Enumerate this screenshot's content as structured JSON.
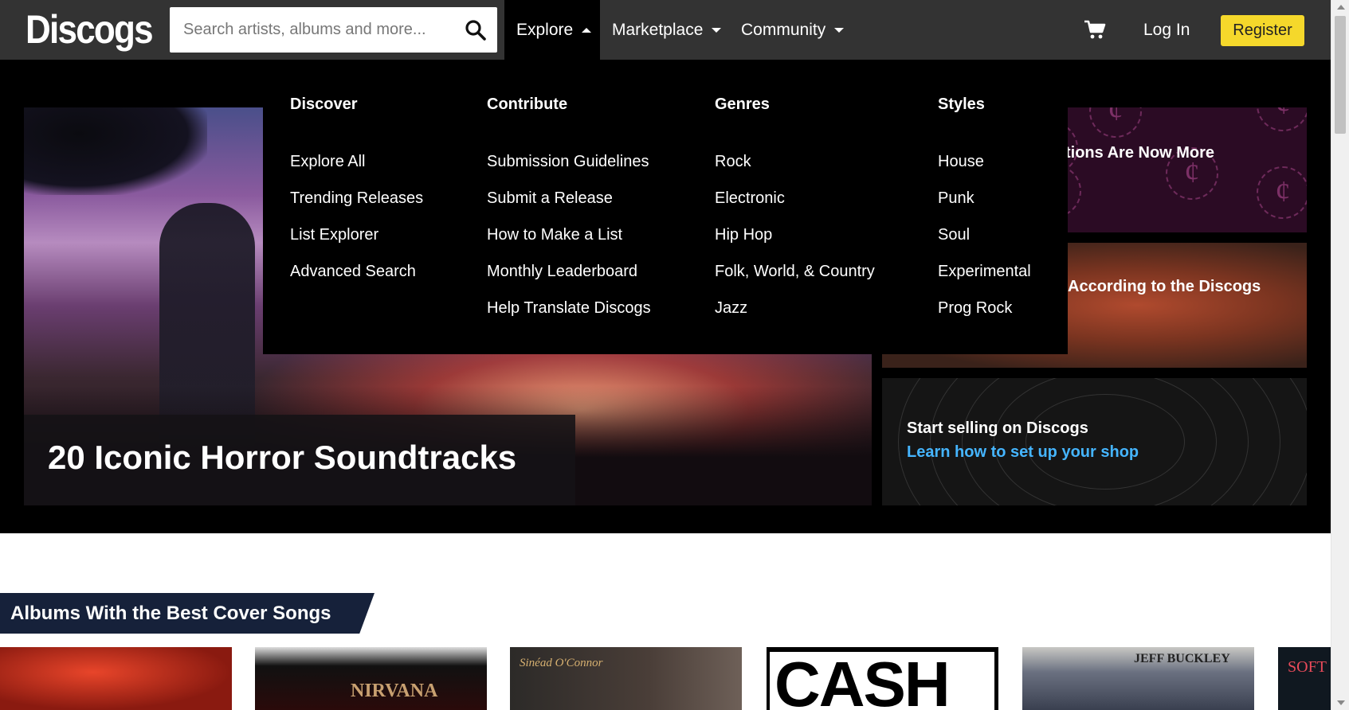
{
  "header": {
    "logo": "Discogs",
    "search_placeholder": "Search artists, albums and more...",
    "nav": [
      {
        "label": "Explore"
      },
      {
        "label": "Marketplace"
      },
      {
        "label": "Community"
      }
    ],
    "login": "Log In",
    "register": "Register"
  },
  "dropdown": {
    "columns": [
      {
        "title": "Discover",
        "items": [
          "Explore All",
          "Trending Releases",
          "List Explorer",
          "Advanced Search"
        ]
      },
      {
        "title": "Contribute",
        "items": [
          "Submission Guidelines",
          "Submit a Release",
          "How to Make a List",
          "Monthly Leaderboard",
          "Help Translate Discogs"
        ]
      },
      {
        "title": "Genres",
        "items": [
          "Rock",
          "Electronic",
          "Hip Hop",
          "Folk, World, & Country",
          "Jazz"
        ]
      },
      {
        "title": "Styles",
        "items": [
          "House",
          "Punk",
          "Soul",
          "Experimental",
          "Prog Rock"
        ]
      }
    ]
  },
  "hero": {
    "main_title": "20 Iconic Horror Soundtracks",
    "card1_title": "tions Are Now More",
    "card2_title": "According to the Discogs",
    "card3_title": "Start selling on Discogs",
    "card3_link": "Learn how to set up your shop"
  },
  "section": {
    "title": "Albums With the Best Cover Songs",
    "album_texts": [
      "NIRVANA",
      "Sinéad O'Connor",
      "CASH",
      "JEFF BUCKLEY",
      "SOFT"
    ]
  },
  "colors": {
    "nav_bg": "#333333",
    "accent_yellow": "#f5d82b",
    "link_blue": "#45b5ff",
    "section_head_bg": "#16213a"
  }
}
